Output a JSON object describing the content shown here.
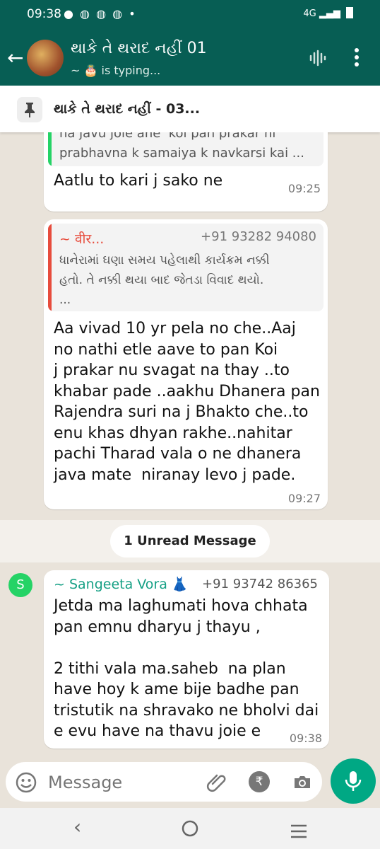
{
  "status_bar": {
    "time": "09:38",
    "notification_icons": "● ◍ ◍ ◍ •",
    "network": "4G"
  },
  "header": {
    "title": "થાકે તે થરાદ નહીં 01",
    "subtitle": "~ 🎂 is typing..."
  },
  "pinned": {
    "text": "થાકે તે થરાદ નહીં - 03..."
  },
  "messages": [
    {
      "quote_text": "Ane jo aave to pan koi e leva same\nna javu joie ane  koi pan prakar ni\nprabhavna k samaiya k navkarsi kai ...",
      "text": "Aatlu to kari j sako ne",
      "time": "09:25"
    },
    {
      "quote_author": "~ वीर...",
      "quote_phone": "+91 93282 94080",
      "quote_text": "ધાનેરામાં ઘણા સમય પહેલાથી કાર્યક્રમ નક્કી\nહતો. તે નક્કી થયા બાદ જેતડા વિવાદ થયો.\n...",
      "text": "Aa vivad 10 yr pela no che..Aaj\nno nathi etle aave to pan Koi\nj prakar nu svagat na thay ..to\nkhabar pade ..aakhu Dhanera pan\nRajendra suri na j Bhakto che..to\nenu khas dhyan rakhe..nahitar\npachi Tharad vala o ne dhanera\njava mate  niranay levo j pade.",
      "time": "09:27"
    },
    {
      "sender": "~ Sangeeta Vora 👗",
      "phone": "+91 93742 86365",
      "avatar_letter": "S",
      "text": "Jetda ma laghumati hova chhata\npan emnu dharyu j thayu ,\n\n2 tithi vala ma.saheb  na plan\nhave hoy k ame bije badhe pan\ntristutik na shravako ne bholvi dai\ne evu have na thavu joie e",
      "time": "09:38"
    }
  ],
  "unread_label": "1 Unread Message",
  "input": {
    "placeholder": "Message"
  },
  "colors": {
    "header": "#075e54",
    "accent": "#00a884",
    "quote_bar_1": "#25d366",
    "quote_bar_2": "#e74c3c",
    "sender_name": "#16a085",
    "quote_author": "#e74c3c"
  }
}
